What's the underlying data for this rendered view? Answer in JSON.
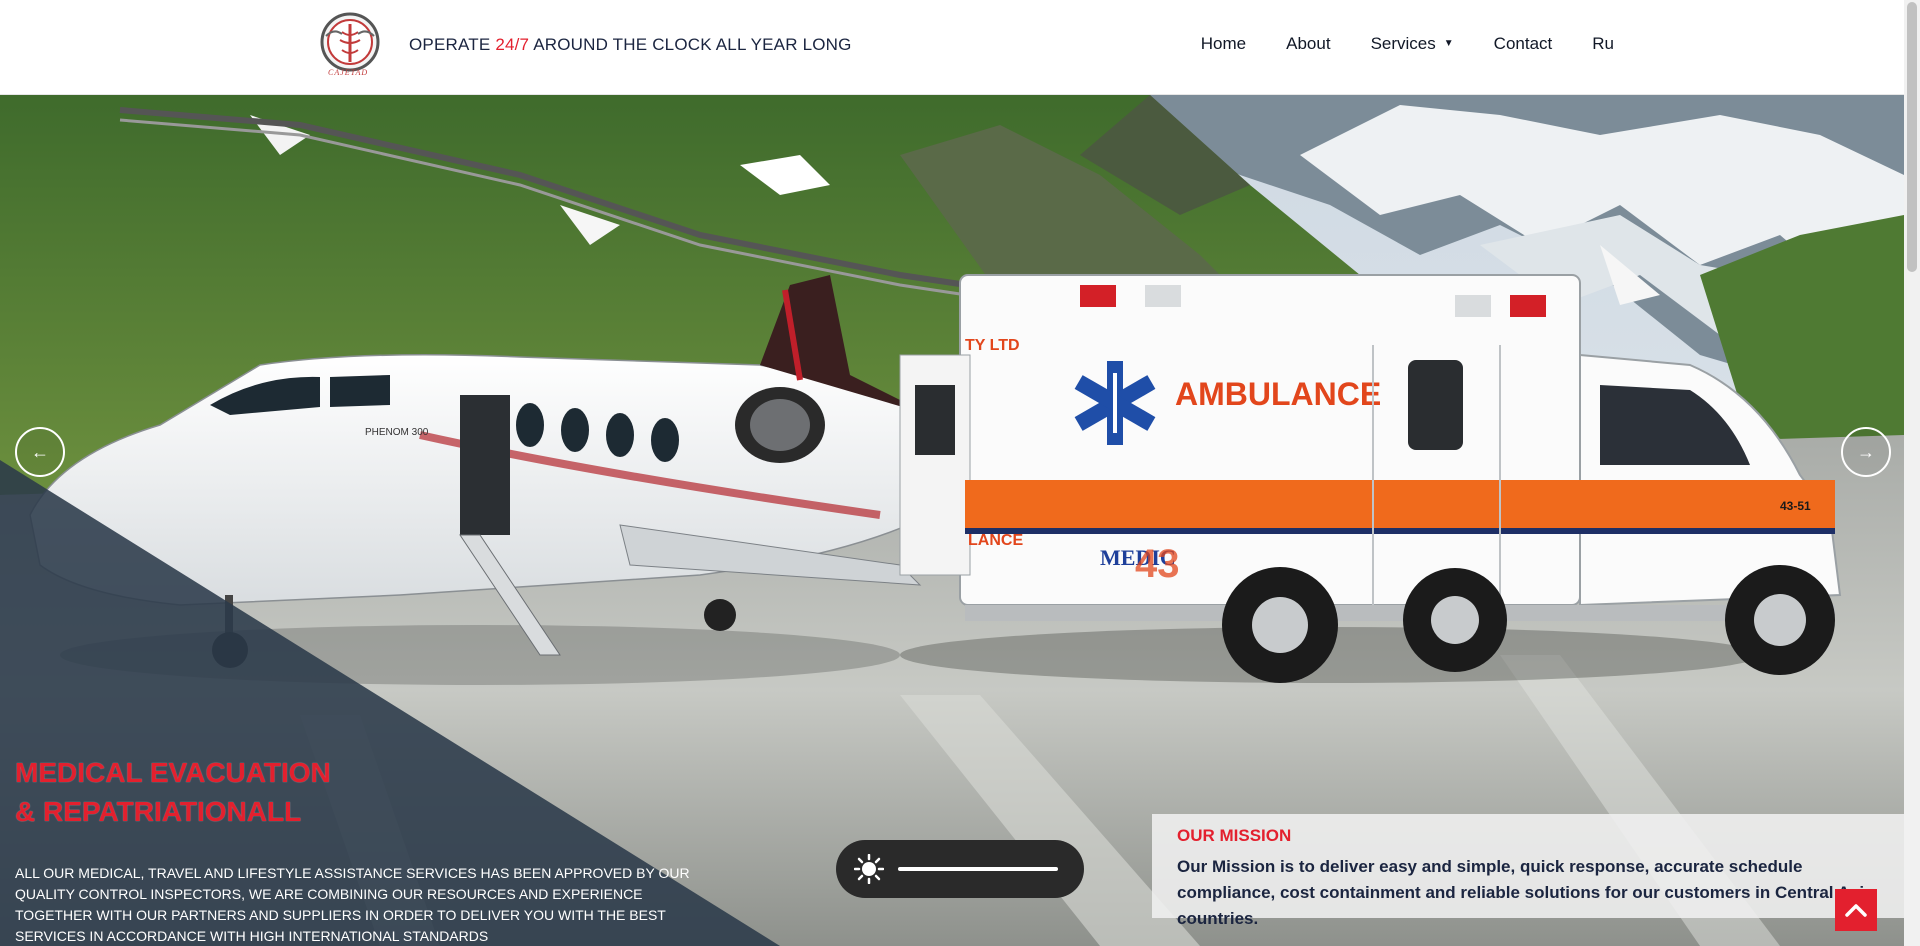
{
  "header": {
    "logo_alt": "CAJETAD logo",
    "logo_text": "CAJETAD",
    "tagline_before": "OPERATE ",
    "tagline_accent": "24/7",
    "tagline_after": " AROUND THE CLOCK ALL YEAR LONG",
    "nav": [
      {
        "label": "Home"
      },
      {
        "label": "About"
      },
      {
        "label": "Services",
        "has_dropdown": true
      },
      {
        "label": "Contact"
      },
      {
        "label": "Ru"
      }
    ]
  },
  "hero": {
    "prev_label": "←",
    "next_label": "→",
    "title_line1": "MEDICAL EVACUATION",
    "title_line2": "& REPATRIATIONALL",
    "description": "ALL OUR MEDICAL, TRAVEL AND LIFESTYLE ASSISTANCE SERVICES HAS BEEN APPROVED BY OUR QUALITY CONTROL INSPECTORS, WE ARE COMBINING OUR RESOURCES AND EXPERIENCE TOGETHER WITH OUR PARTNERS AND SUPPLIERS IN ORDER TO DELIVER YOU WITH THE BEST SERVICES IN ACCORDANCE WITH HIGH INTERNATIONAL STANDARDS",
    "image_text": {
      "ambulance": "AMBULANCE",
      "medic": "MEDIC",
      "unit_number": "43",
      "side_number": "43-51",
      "ltd": "TY LTD",
      "lance": "LANCE",
      "jet_model": "PHENOM 300"
    }
  },
  "mission": {
    "title": "OUR MISSION",
    "text": "Our Mission is to deliver easy and simple, quick response, accurate schedule compliance, cost containment and reliable solutions for our customers in Central Asia countries."
  },
  "theme_toggle": {
    "icon": "sun-icon"
  },
  "scroll_top": {
    "icon": "chevron-up-icon"
  },
  "colors": {
    "accent": "#e3202e",
    "navy": "#1b2540",
    "overlay": "#2b3a4a"
  }
}
